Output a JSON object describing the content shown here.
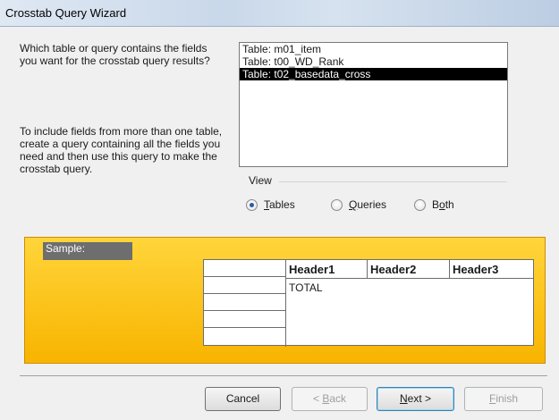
{
  "window": {
    "title": "Crosstab Query Wizard"
  },
  "instructions": {
    "question": "Which table or query contains the fields you want for the crosstab query results?",
    "help": "To include fields from more than one table, create a query containing all the fields you need and then use this query to make the crosstab query."
  },
  "source_list": {
    "items": [
      "Table: m01_item",
      "Table: t00_WD_Rank",
      "Table: t02_basedata_cross"
    ],
    "selected_index": 2
  },
  "view": {
    "label": "View",
    "options": [
      {
        "key": "T",
        "rest": "ables",
        "selected": true
      },
      {
        "key": "Q",
        "rest": "ueries",
        "selected": false
      },
      {
        "prefix": "B",
        "key": "o",
        "rest": "th",
        "selected": false
      }
    ]
  },
  "sample": {
    "label": "Sample:",
    "headers": [
      "Header1",
      "Header2",
      "Header3"
    ],
    "total_label": "TOTAL"
  },
  "buttons": {
    "cancel": "Cancel",
    "back": {
      "prefix": "< ",
      "key": "B",
      "rest": "ack"
    },
    "next": {
      "key": "N",
      "rest": "ext >"
    },
    "finish": {
      "key": "F",
      "rest": "inish"
    }
  }
}
